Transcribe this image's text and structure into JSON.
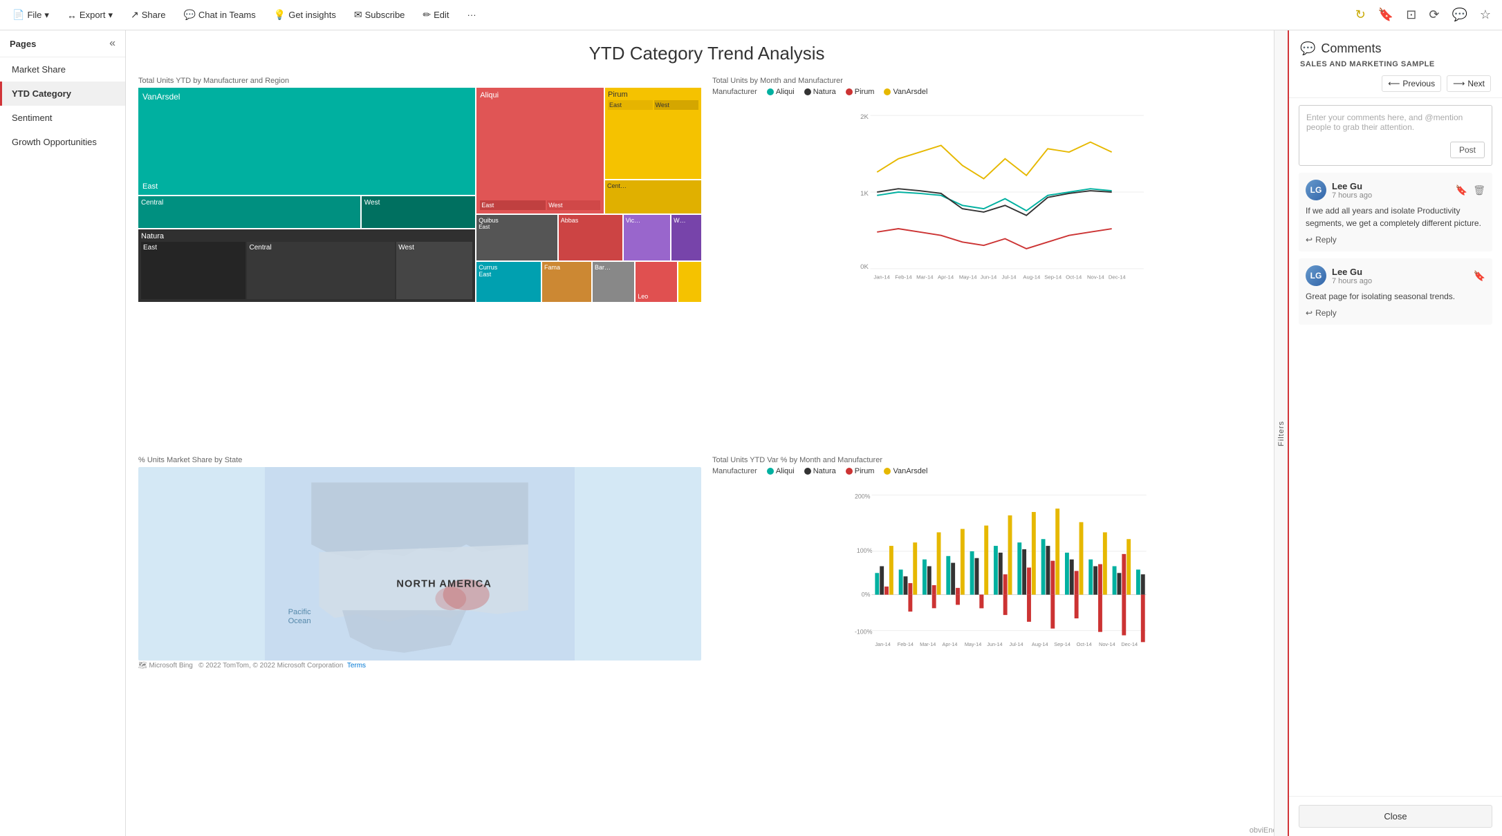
{
  "topbar": {
    "file_label": "File",
    "export_label": "Export",
    "share_label": "Share",
    "chat_in_teams_label": "Chat in Teams",
    "get_insights_label": "Get insights",
    "subscribe_label": "Subscribe",
    "edit_label": "Edit",
    "more_label": "···"
  },
  "sidebar": {
    "title": "Pages",
    "items": [
      {
        "label": "Market Share",
        "active": false
      },
      {
        "label": "YTD Category",
        "active": true
      },
      {
        "label": "Sentiment",
        "active": false
      },
      {
        "label": "Growth Opportunities",
        "active": false
      }
    ]
  },
  "page": {
    "title": "YTD Category Trend Analysis"
  },
  "filters": {
    "label": "Filters"
  },
  "charts": {
    "treemap_title": "Total Units YTD by Manufacturer and Region",
    "linechart_title": "Total Units by Month and Manufacturer",
    "map_title": "% Units Market Share by State",
    "barchart_title": "Total Units YTD Var % by Month and Manufacturer",
    "line_legend": {
      "manufacturer_label": "Manufacturer",
      "items": [
        {
          "name": "Aliqui",
          "color": "#00b0a0"
        },
        {
          "name": "Natura",
          "color": "#333333"
        },
        {
          "name": "Pirum",
          "color": "#cc3333"
        },
        {
          "name": "VanArsdel",
          "color": "#e6b800"
        }
      ]
    },
    "bar_legend": {
      "manufacturer_label": "Manufacturer",
      "items": [
        {
          "name": "Aliqui",
          "color": "#00b0a0"
        },
        {
          "name": "Natura",
          "color": "#333333"
        },
        {
          "name": "Pirum",
          "color": "#cc3333"
        },
        {
          "name": "VanArsdel",
          "color": "#e6b800"
        }
      ]
    },
    "map": {
      "region_label": "NORTH AMERICA",
      "ocean_label": "Pacific\nOcean",
      "footer": "Microsoft Bing",
      "copyright": "© 2022 TomTom, © 2022 Microsoft Corporation",
      "terms_label": "Terms"
    },
    "obv": "obviEnce"
  },
  "comments": {
    "title": "Comments",
    "subtitle": "SALES AND MARKETING SAMPLE",
    "input_placeholder": "Enter your comments here, and @mention people to grab their attention.",
    "post_label": "Post",
    "previous_label": "Previous",
    "next_label": "Next",
    "entries": [
      {
        "id": 1,
        "username": "Lee Gu",
        "time": "7 hours ago",
        "text": "If we add all years and isolate Productivity segments, we get a completely different picture.",
        "reply_label": "Reply"
      },
      {
        "id": 2,
        "username": "Lee Gu",
        "time": "7 hours ago",
        "text": "Great page for isolating seasonal trends.",
        "reply_label": "Reply"
      }
    ],
    "close_label": "Close"
  }
}
